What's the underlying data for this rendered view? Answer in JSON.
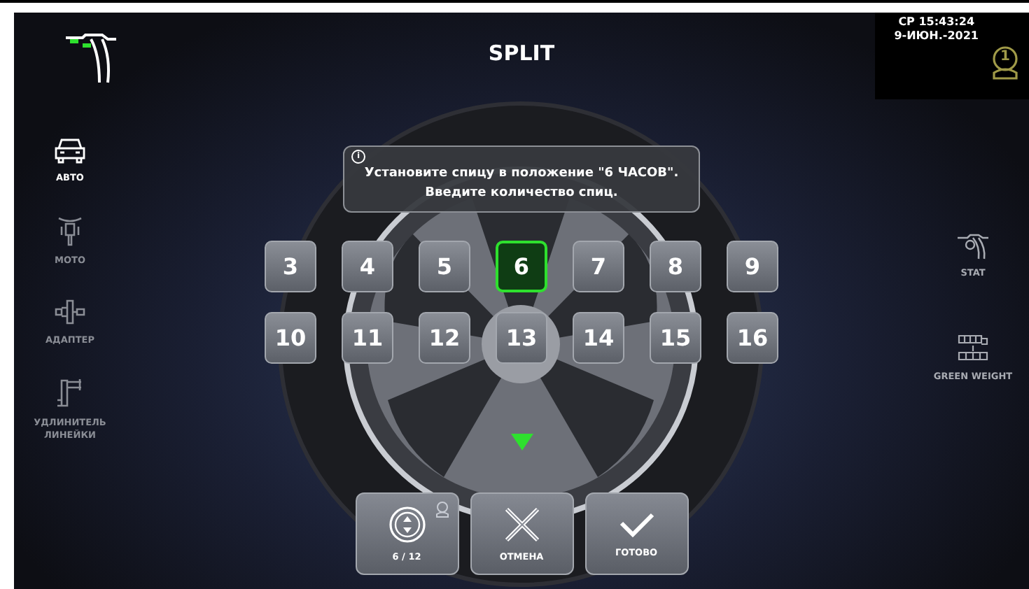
{
  "header": {
    "title": "SPLIT",
    "day_time": "СР 15:43:24",
    "date": "9-ИЮН.-2021",
    "user_badge": "1"
  },
  "left_menu": [
    {
      "kind": "car",
      "label": "АВТО",
      "selected": true
    },
    {
      "kind": "moto",
      "label": "МОТО",
      "selected": false
    },
    {
      "kind": "adapter",
      "label": "АДАПТЕР",
      "selected": false
    },
    {
      "kind": "extender",
      "label": "УДЛИНИТЕЛЬ ЛИНЕЙКИ",
      "selected": false
    }
  ],
  "message": {
    "icon": "i",
    "lines": [
      "Установите спицу в положение \"6 ЧАСОВ\".",
      "Введите количество спиц."
    ]
  },
  "keypad": [
    {
      "label": "3",
      "selected": false
    },
    {
      "label": "4",
      "selected": false
    },
    {
      "label": "5",
      "selected": false
    },
    {
      "label": "6",
      "selected": true
    },
    {
      "label": "7",
      "selected": false
    },
    {
      "label": "8",
      "selected": false
    },
    {
      "label": "9",
      "selected": false
    },
    {
      "label": "10",
      "selected": false
    },
    {
      "label": "11",
      "selected": false
    },
    {
      "label": "12",
      "selected": false
    },
    {
      "label": "13",
      "selected": false
    },
    {
      "label": "14",
      "selected": false
    },
    {
      "label": "15",
      "selected": false
    },
    {
      "label": "16",
      "selected": false
    }
  ],
  "bottom_buttons": [
    {
      "kind": "counter",
      "label": "6 / 12"
    },
    {
      "kind": "cancel",
      "label": "ОТМЕНА"
    },
    {
      "kind": "done",
      "label": "ГОТОВО"
    }
  ],
  "right_menu": [
    {
      "kind": "stat",
      "label": "STAT"
    },
    {
      "kind": "weight",
      "label": "GREEN WEIGHT"
    }
  ]
}
